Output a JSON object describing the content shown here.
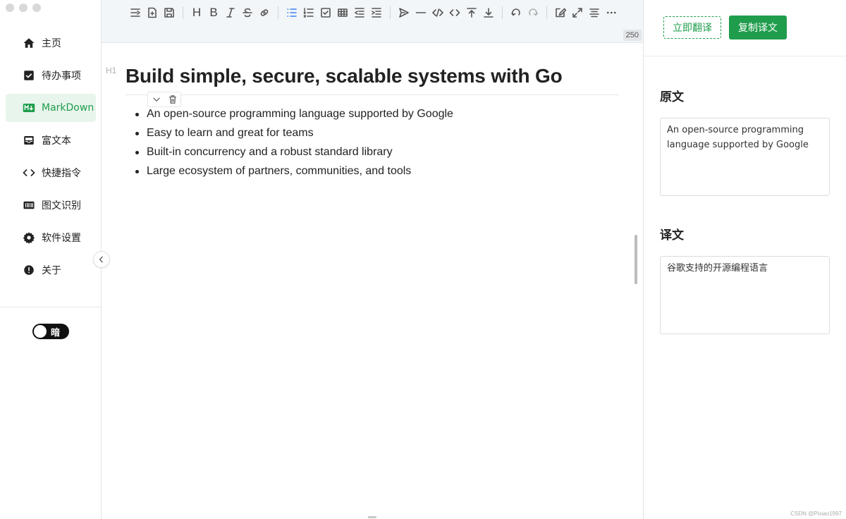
{
  "sidebar": {
    "items": [
      {
        "label": "主页",
        "icon": "home-icon"
      },
      {
        "label": "待办事项",
        "icon": "checkbox-icon"
      },
      {
        "label": "MarkDown",
        "icon": "markdown-icon"
      },
      {
        "label": "富文本",
        "icon": "inbox-icon"
      },
      {
        "label": "快捷指令",
        "icon": "code-icon"
      },
      {
        "label": "图文识别",
        "icon": "barcode-icon"
      },
      {
        "label": "软件设置",
        "icon": "gear-icon"
      },
      {
        "label": "关于",
        "icon": "info-icon"
      }
    ],
    "active_index": 2,
    "theme_toggle_label": "暗"
  },
  "editor": {
    "char_count": "250",
    "heading_marker": "H1",
    "heading": "Build simple, secure, scalable systems with Go",
    "bullets": [
      "An open-source programming language supported by Google",
      "Easy to learn and great for teams",
      "Built-in concurrency and a robust standard library",
      "Large ecosystem of partners, communities, and tools"
    ],
    "toolbar": {
      "bold": "B",
      "heading": "H"
    }
  },
  "panel": {
    "translate_button": "立即翻译",
    "copy_button": "复制译文",
    "source_title": "原文",
    "source_text": "An open-source programming language supported by Google",
    "target_title": "译文",
    "target_text": "谷歌支持的开源编程语言"
  },
  "watermark": "CSDN @Pixiao1997",
  "colors": {
    "accent": "#1f9d4c",
    "active_bg": "#e8f5ec",
    "toolbar_bg": "#f3f6f8"
  }
}
